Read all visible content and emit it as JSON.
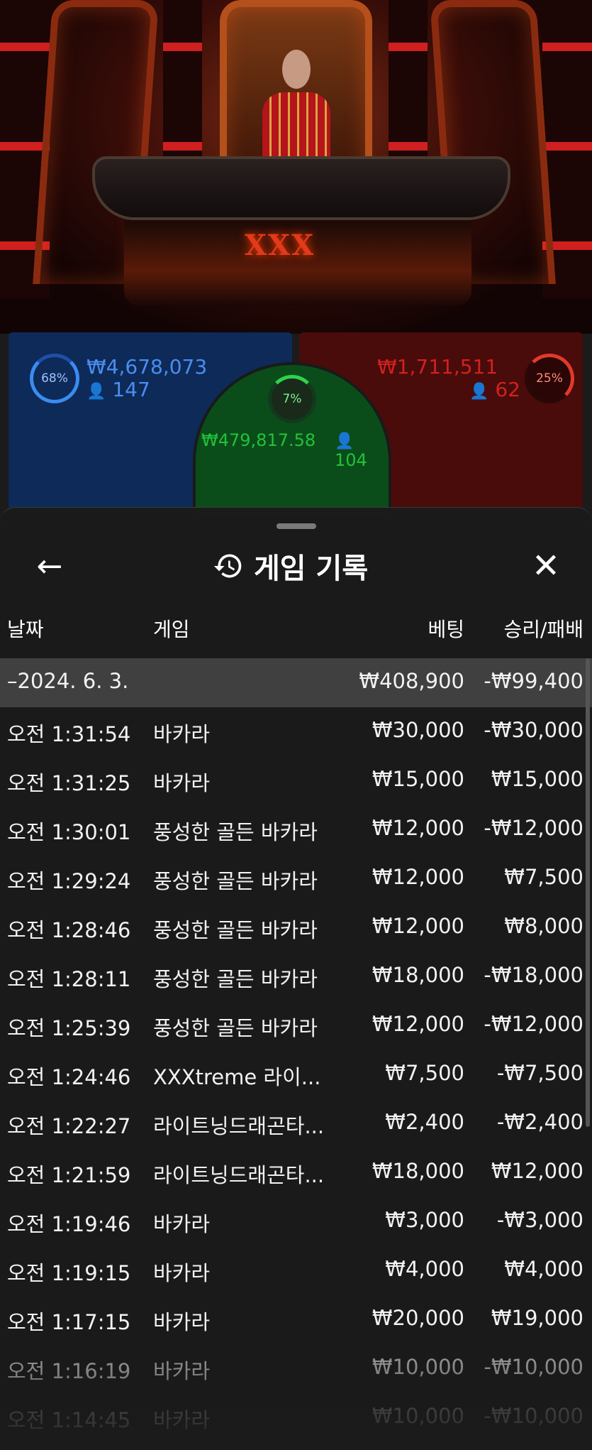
{
  "bets": {
    "player": {
      "percent": "68%",
      "amount": "₩4,678,073",
      "count": "147"
    },
    "banker": {
      "percent": "25%",
      "amount": "₩1,711,511",
      "count": "62"
    },
    "tie": {
      "percent": "7%",
      "amount": "₩479,817.58",
      "count": "104"
    }
  },
  "header": {
    "title": "게임 기록",
    "back_icon": "←",
    "history_icon": "history-icon",
    "close_icon": "✕"
  },
  "columns": {
    "date": "날짜",
    "game": "게임",
    "bet": "베팅",
    "result": "승리/패배"
  },
  "date_group": {
    "date": "–2024. 6. 3.",
    "total_bet": "₩408,900",
    "total_result": "-₩99,400"
  },
  "rows": [
    {
      "time": "오전 1:31:54",
      "game": "바카라",
      "bet": "₩30,000",
      "result": "-₩30,000"
    },
    {
      "time": "오전 1:31:25",
      "game": "바카라",
      "bet": "₩15,000",
      "result": "₩15,000"
    },
    {
      "time": "오전 1:30:01",
      "game": "풍성한 골든 바카라",
      "bet": "₩12,000",
      "result": "-₩12,000"
    },
    {
      "time": "오전 1:29:24",
      "game": "풍성한 골든 바카라",
      "bet": "₩12,000",
      "result": "₩7,500"
    },
    {
      "time": "오전 1:28:46",
      "game": "풍성한 골든 바카라",
      "bet": "₩12,000",
      "result": "₩8,000"
    },
    {
      "time": "오전 1:28:11",
      "game": "풍성한 골든 바카라",
      "bet": "₩18,000",
      "result": "-₩18,000"
    },
    {
      "time": "오전 1:25:39",
      "game": "풍성한 골든 바카라",
      "bet": "₩12,000",
      "result": "-₩12,000"
    },
    {
      "time": "오전 1:24:46",
      "game": "XXXtreme 라이...",
      "bet": "₩7,500",
      "result": "-₩7,500"
    },
    {
      "time": "오전 1:22:27",
      "game": "라이트닝드래곤타...",
      "bet": "₩2,400",
      "result": "-₩2,400"
    },
    {
      "time": "오전 1:21:59",
      "game": "라이트닝드래곤타...",
      "bet": "₩18,000",
      "result": "₩12,000"
    },
    {
      "time": "오전 1:19:46",
      "game": "바카라",
      "bet": "₩3,000",
      "result": "-₩3,000"
    },
    {
      "time": "오전 1:19:15",
      "game": "바카라",
      "bet": "₩4,000",
      "result": "₩4,000"
    },
    {
      "time": "오전 1:17:15",
      "game": "바카라",
      "bet": "₩20,000",
      "result": "₩19,000"
    },
    {
      "time": "오전 1:16:19",
      "game": "바카라",
      "bet": "₩10,000",
      "result": "-₩10,000"
    },
    {
      "time": "오전 1:14:45",
      "game": "바카라",
      "bet": "₩10,000",
      "result": "-₩10,000"
    }
  ]
}
